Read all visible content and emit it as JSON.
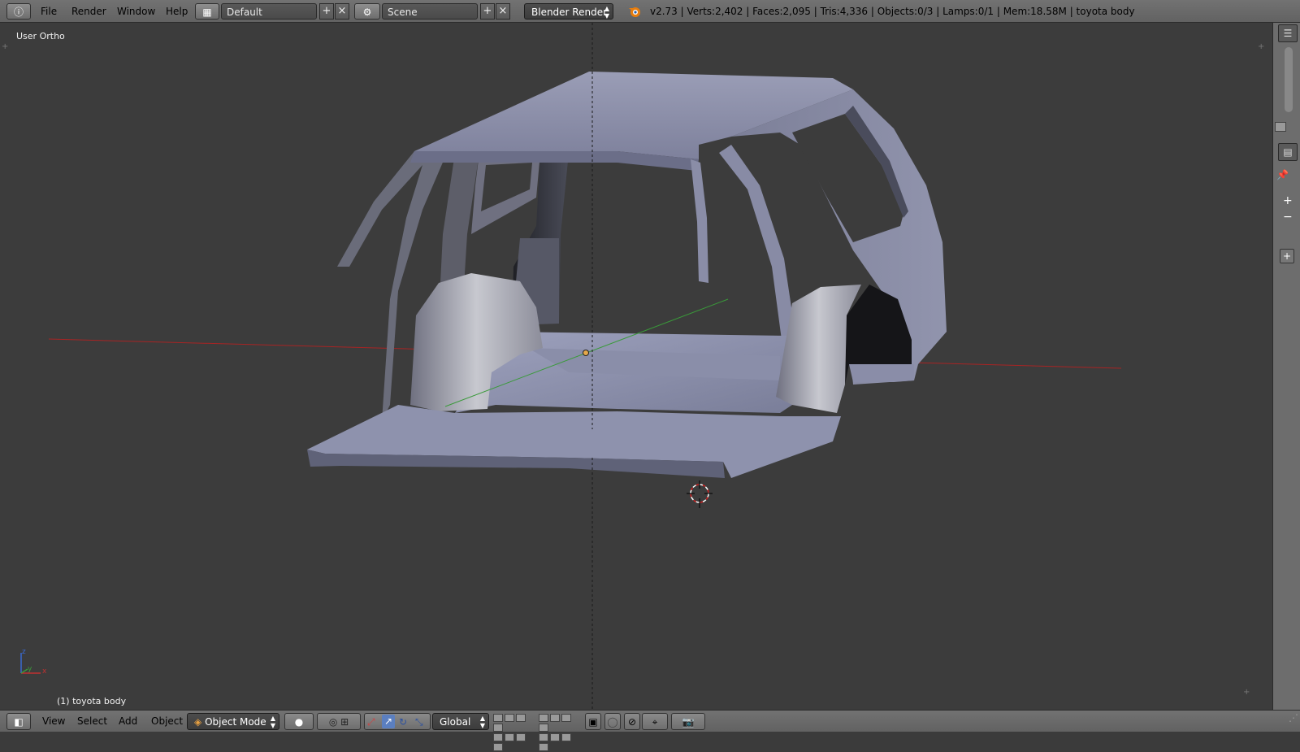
{
  "top_bar": {
    "menu": [
      "File",
      "Render",
      "Window",
      "Help"
    ],
    "screen_layout": "Default",
    "scene": "Scene",
    "render_engine": "Blender Render",
    "stats": "v2.73 | Verts:2,402 | Faces:2,095 | Tris:4,336 | Objects:0/3 | Lamps:0/1 | Mem:18.58M | toyota body",
    "icons": [
      "info-icon",
      "screen-layout-icon",
      "scene-icon",
      "blender-logo-icon"
    ]
  },
  "viewport": {
    "view_label": "User Ortho",
    "object_label": "(1) toyota body",
    "axis_gizmo": {
      "x": "x",
      "y": "y",
      "z": "z"
    },
    "colors": {
      "background": "#3c3c3c",
      "x_axis": "#a82424",
      "y_axis": "#3a9a3a",
      "mesh": "#8f93ad"
    }
  },
  "bottom_bar": {
    "menu": [
      "View",
      "Select",
      "Add",
      "Object"
    ],
    "mode": "Object Mode",
    "orientation": "Global",
    "icons": [
      "editor-type-icon",
      "viewport-shading-icon",
      "pivot-point-icon",
      "manipulator-icon",
      "translate-icon",
      "rotate-icon",
      "scale-icon",
      "layers-icon",
      "lock-icon",
      "proportional-edit-icon",
      "snap-icon",
      "render-preview-icon"
    ]
  },
  "right_strip": {
    "icons": [
      "outliner-icon",
      "properties-icon",
      "pin-icon",
      "zoom-in-icon",
      "zoom-out-icon",
      "add-icon"
    ]
  }
}
